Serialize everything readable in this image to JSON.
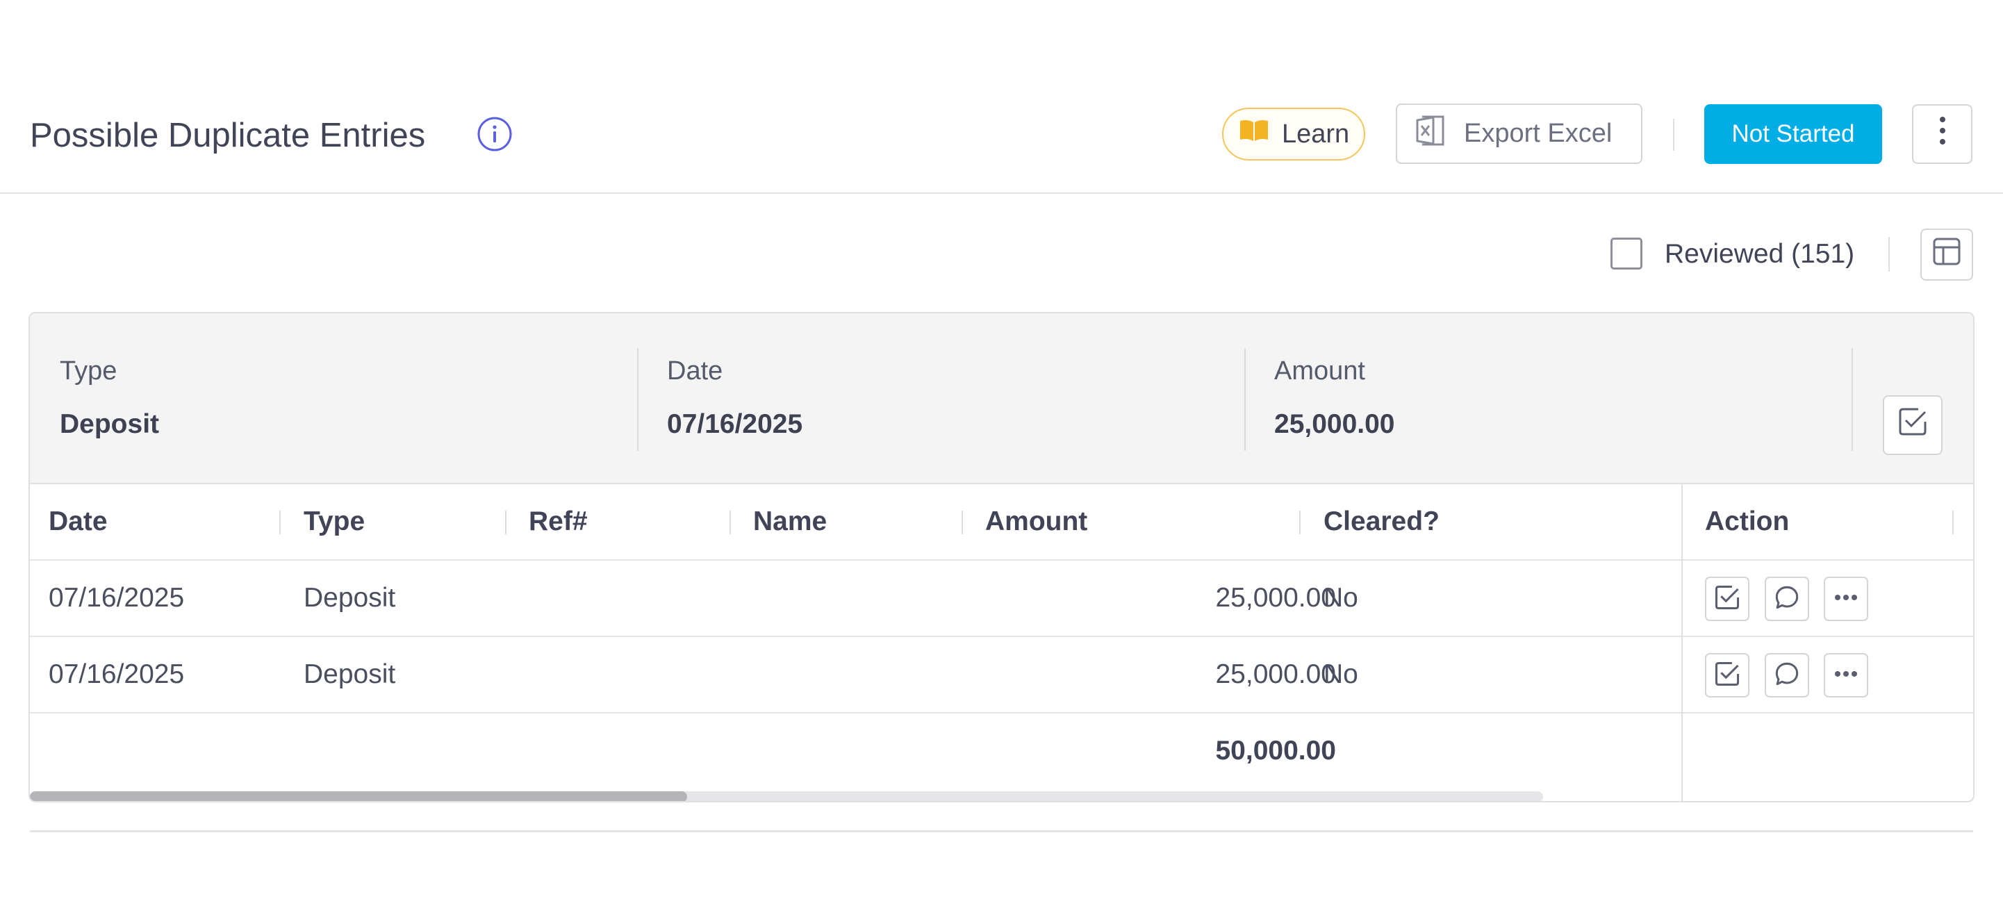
{
  "header": {
    "title": "Possible Duplicate Entries",
    "learn_label": "Learn",
    "export_label": "Export Excel",
    "status_label": "Not Started"
  },
  "toolbar": {
    "reviewed_label": "Reviewed (151)",
    "reviewed_checked": false
  },
  "group": {
    "type_label": "Type",
    "type_value": "Deposit",
    "date_label": "Date",
    "date_value": "07/16/2025",
    "amount_label": "Amount",
    "amount_value": "25,000.00"
  },
  "table": {
    "columns": [
      "Date",
      "Type",
      "Ref#",
      "Name",
      "Amount",
      "Cleared?",
      "Action"
    ],
    "rows": [
      {
        "date": "07/16/2025",
        "type": "Deposit",
        "ref": "",
        "name": "",
        "amount": "25,000.00",
        "cleared": "No"
      },
      {
        "date": "07/16/2025",
        "type": "Deposit",
        "ref": "",
        "name": "",
        "amount": "25,000.00",
        "cleared": "No"
      }
    ],
    "total_amount": "50,000.00"
  },
  "colors": {
    "accent": "#00ade5",
    "learn_border": "#f5c65b",
    "learn_icon": "#f4b324",
    "info_icon": "#5b5fe0"
  },
  "icons": {
    "info": "info-icon",
    "learn": "book-icon",
    "export": "excel-icon",
    "kebab": "kebab-icon",
    "columns": "columns-icon",
    "review": "check-square-icon",
    "comment": "comment-icon",
    "more": "more-icon"
  }
}
